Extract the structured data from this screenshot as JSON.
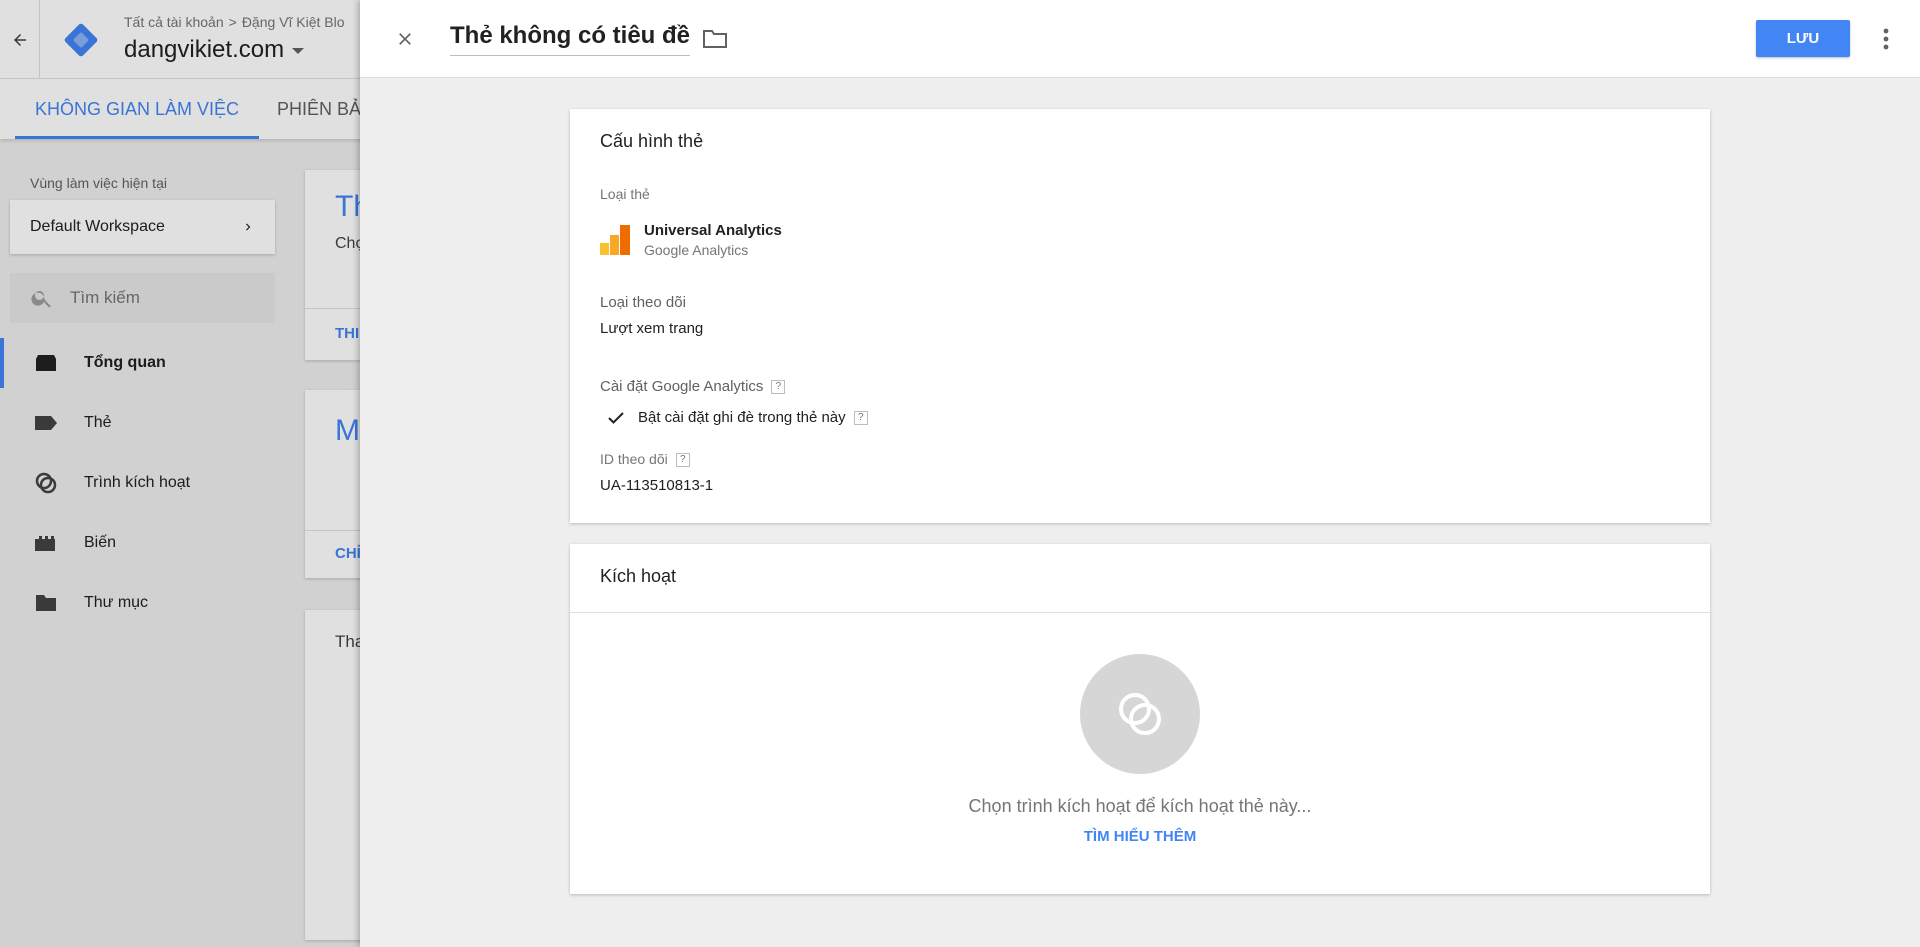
{
  "background_app": {
    "breadcrumb": [
      "Tất cả tài khoản",
      "Đặng Vĩ Kiệt Blo"
    ],
    "container_name": "dangvikiet.com",
    "tabs": [
      {
        "label": "KHÔNG GIAN LÀM VIỆC",
        "active": true
      },
      {
        "label": "PHIÊN BẢN",
        "active": false
      }
    ],
    "workspace_label": "Vùng làm việc hiện tại",
    "workspace_name": "Default Workspace",
    "search_placeholder": "Tìm kiếm",
    "nav": [
      {
        "label": "Tổng quan",
        "icon": "overview-icon",
        "active": true
      },
      {
        "label": "Thẻ",
        "icon": "tag-icon",
        "active": false
      },
      {
        "label": "Trình kích hoạt",
        "icon": "trigger-icon",
        "active": false
      },
      {
        "label": "Biến",
        "icon": "variable-icon",
        "active": false
      },
      {
        "label": "Thư mục",
        "icon": "folder-icon",
        "active": false
      }
    ],
    "cards": [
      {
        "big": "Th",
        "small": "Chọ",
        "link": "THI"
      },
      {
        "big": "M",
        "link": "CHỈ"
      },
      {
        "small": "Tha"
      }
    ]
  },
  "editor": {
    "title": "Thẻ không có tiêu đề",
    "save_label": "LƯU",
    "accent_color": "#4285f4",
    "tag_config": {
      "section_title": "Cấu hình thẻ",
      "tag_type_label": "Loại thẻ",
      "tag_type_name": "Universal Analytics",
      "tag_type_vendor": "Google Analytics",
      "track_type_label": "Loại theo dõi",
      "track_type_value": "Lượt xem trang",
      "ga_settings_label": "Cài đặt Google Analytics",
      "override_label": "Bật cài đặt ghi đè trong thẻ này",
      "override_checked": true,
      "tracking_id_label": "ID theo dõi",
      "tracking_id_value": "UA-113510813-1",
      "help_glyph": "?"
    },
    "triggering": {
      "section_title": "Kích hoạt",
      "empty_text": "Chọn trình kích hoạt để kích hoạt thẻ này...",
      "learn_more": "TÌM HIỂU THÊM"
    }
  }
}
